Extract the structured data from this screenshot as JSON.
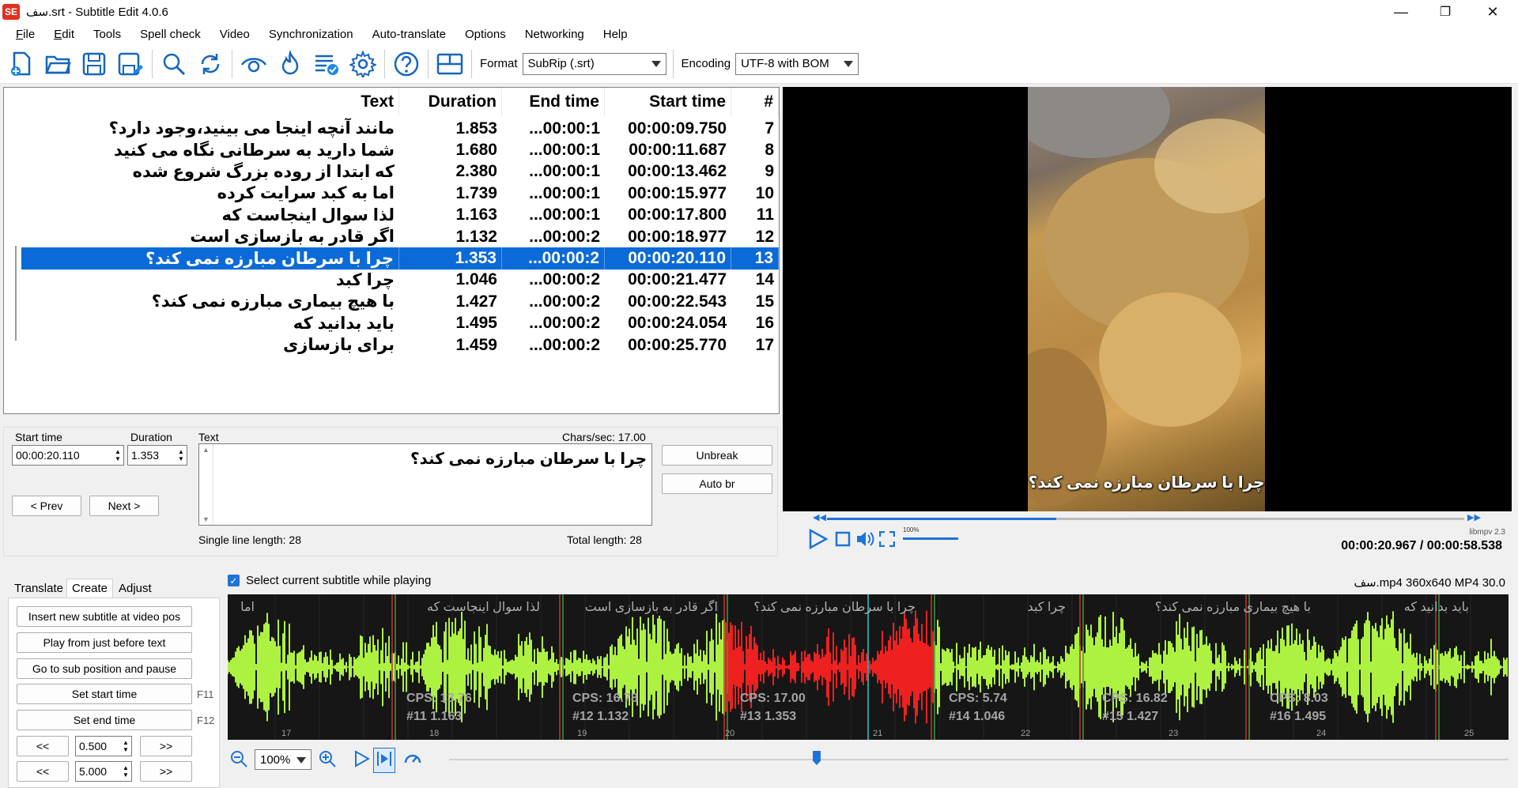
{
  "window": {
    "title": "سف.srt - Subtitle Edit 4.0.6",
    "logo": "SE"
  },
  "menu": [
    "File",
    "Edit",
    "Tools",
    "Spell check",
    "Video",
    "Synchronization",
    "Auto-translate",
    "Options",
    "Networking",
    "Help"
  ],
  "toolbar": {
    "format_label": "Format",
    "format_value": "SubRip (.srt)",
    "encoding_label": "Encoding",
    "encoding_value": "UTF-8 with BOM"
  },
  "list": {
    "headers": {
      "text": "Text",
      "duration": "Duration",
      "end": "End time",
      "start": "Start time",
      "num": "#"
    },
    "rows": [
      {
        "num": "7",
        "start": "00:00:09.750",
        "end": "...00:00:1",
        "duration": "1.853",
        "text": "مانند آنچه اینجا می بینید،وجود دارد؟"
      },
      {
        "num": "8",
        "start": "00:00:11.687",
        "end": "...00:00:1",
        "duration": "1.680",
        "text": "شما دارید به سرطانی نگاه می کنید"
      },
      {
        "num": "9",
        "start": "00:00:13.462",
        "end": "...00:00:1",
        "duration": "2.380",
        "text": "که ابتدا از روده بزرگ شروع شده"
      },
      {
        "num": "10",
        "start": "00:00:15.977",
        "end": "...00:00:1",
        "duration": "1.739",
        "text": "اما به کبد سرایت کرده"
      },
      {
        "num": "11",
        "start": "00:00:17.800",
        "end": "...00:00:1",
        "duration": "1.163",
        "text": "لذا سوال اینجاست که"
      },
      {
        "num": "12",
        "start": "00:00:18.977",
        "end": "...00:00:2",
        "duration": "1.132",
        "text": "اگر قادر به بازسازی است"
      },
      {
        "num": "13",
        "start": "00:00:20.110",
        "end": "...00:00:2",
        "duration": "1.353",
        "text": "چرا با سرطان مبارزه نمی کند؟"
      },
      {
        "num": "14",
        "start": "00:00:21.477",
        "end": "...00:00:2",
        "duration": "1.046",
        "text": "چرا کبد"
      },
      {
        "num": "15",
        "start": "00:00:22.543",
        "end": "...00:00:2",
        "duration": "1.427",
        "text": "با هیچ بیماری مبارزه نمی کند؟"
      },
      {
        "num": "16",
        "start": "00:00:24.054",
        "end": "...00:00:2",
        "duration": "1.495",
        "text": "باید بدانید که"
      },
      {
        "num": "17",
        "start": "00:00:25.770",
        "end": "...00:00:2",
        "duration": "1.459",
        "text": "برای بازسازی"
      }
    ],
    "selected_index": 6
  },
  "video": {
    "subtitle": "چرا با سرطان مبارزه نمی کند؟",
    "timecode": "00:00:20.967 / 00:00:58.538",
    "engine": "libmpv 2.3",
    "volume_label": "100%",
    "progress": 0.36
  },
  "edit": {
    "start_label": "Start time",
    "start_value": "00:00:20.110",
    "duration_label": "Duration",
    "duration_value": "1.353",
    "text_label": "Text",
    "chars_sec": "Chars/sec: 17.00",
    "text_value": "چرا با سرطان مبارزه نمی کند؟",
    "unbreak": "Unbreak",
    "auto_br": "Auto br",
    "prev": "< Prev",
    "next": "Next >",
    "single_line": "Single line length: 28",
    "total_length": "Total length: 28"
  },
  "bottom": {
    "tabs": [
      "Translate",
      "Create",
      "Adjust"
    ],
    "active_tab": "Create",
    "select_current": "Select current subtitle while playing",
    "video_info": "سف.mp4 360x640 MP4 30.0",
    "buttons": {
      "insert": "Insert new subtitle at video pos",
      "play_before": "Play from just before text",
      "goto_sub": "Go to sub position and pause",
      "set_start": "Set start time",
      "set_end": "Set end time",
      "back": "<<",
      "fwd": ">>"
    },
    "shortcut_start": "F11",
    "shortcut_end": "F12",
    "step_small": "0.500",
    "step_large": "5.000",
    "zoom": "100%"
  },
  "waveform": {
    "segments": [
      {
        "text": "اما",
        "cps": "",
        "id": ""
      },
      {
        "text": "لذا سوال اینجاست که",
        "cps": "CPS: 13.76",
        "id": "#11  1.163"
      },
      {
        "text": "اگر قادر به بازسازی است",
        "cps": "CPS: 16.78",
        "id": "#12  1.132"
      },
      {
        "text": "چرا با سرطان مبارزه نمی کند؟",
        "cps": "CPS: 17.00",
        "id": "#13  1.353"
      },
      {
        "text": "چرا کبد",
        "cps": "CPS: 5.74",
        "id": "#14  1.046"
      },
      {
        "text": "با هیچ بیماری مبارزه نمی کند؟",
        "cps": "CPS: 16.82",
        "id": "#15  1.427"
      },
      {
        "text": "باید بدانید که",
        "cps": "CPS: 8.03",
        "id": "#16  1.495"
      }
    ],
    "ticks": [
      "17",
      "18",
      "19",
      "20",
      "21",
      "22",
      "23",
      "24",
      "25"
    ],
    "colors": {
      "normal": "#aef241",
      "selected": "#ee2020",
      "background": "#161616"
    }
  }
}
